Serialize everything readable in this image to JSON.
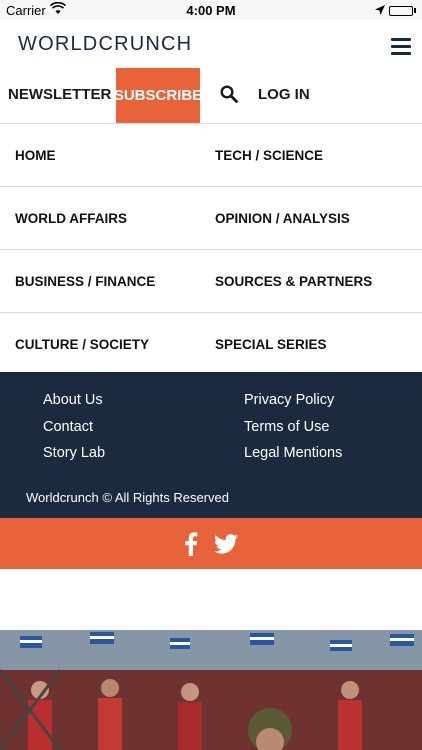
{
  "status_bar": {
    "carrier": "Carrier",
    "time": "4:00 PM"
  },
  "header": {
    "logo": "WORLDCRUNCH"
  },
  "actions": {
    "newsletter": "NEWSLETTER",
    "subscribe": "SUBSCRIBE",
    "login": "LOG IN"
  },
  "menu": {
    "rows": [
      {
        "left": "HOME",
        "right": "TECH / SCIENCE"
      },
      {
        "left": "WORLD AFFAIRS",
        "right": "OPINION / ANALYSIS"
      },
      {
        "left": "BUSINESS / FINANCE",
        "right": "SOURCES & PARTNERS"
      },
      {
        "left": "CULTURE / SOCIETY",
        "right": "SPECIAL SERIES"
      }
    ]
  },
  "footer": {
    "left_links": [
      "About Us",
      "Contact",
      "Story Lab"
    ],
    "right_links": [
      "Privacy Policy",
      "Terms of Use",
      "Legal Mentions"
    ],
    "copyright": "Worldcrunch © All Rights Reserved"
  },
  "social": {
    "icons": [
      "facebook-icon",
      "twitter-icon"
    ]
  },
  "colors": {
    "accent": "#e8623a",
    "navy": "#1b2a3f"
  }
}
